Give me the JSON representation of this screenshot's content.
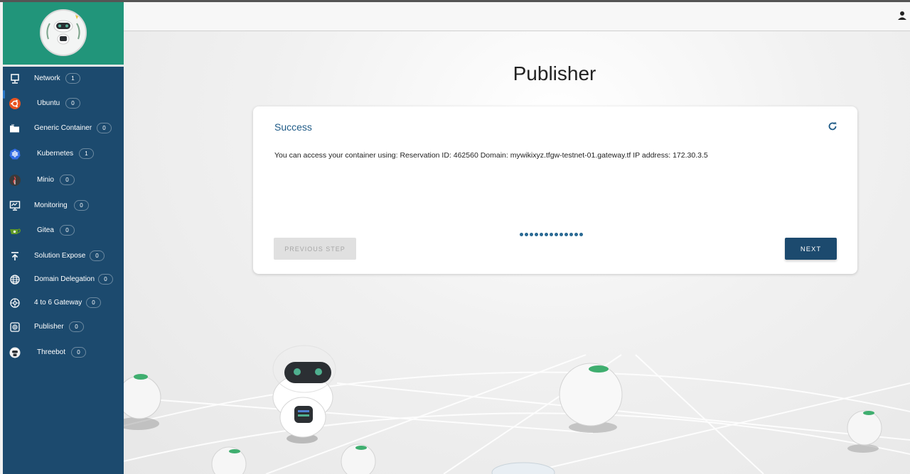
{
  "sidebar": {
    "items": [
      {
        "label": "Network",
        "count": "1",
        "icon": "monitor-icon"
      },
      {
        "label": "Ubuntu",
        "count": "0",
        "icon": "ubuntu-icon"
      },
      {
        "label": "Generic Container",
        "count": "0",
        "icon": "folder-icon"
      },
      {
        "label": "Kubernetes",
        "count": "1",
        "icon": "kubernetes-icon"
      },
      {
        "label": "Minio",
        "count": "0",
        "icon": "minio-icon"
      },
      {
        "label": "Monitoring",
        "count": "0",
        "icon": "monitoring-icon"
      },
      {
        "label": "Gitea",
        "count": "0",
        "icon": "gitea-icon"
      },
      {
        "label": "Solution Expose",
        "count": "0",
        "icon": "upload-icon"
      },
      {
        "label": "Domain Delegation",
        "count": "0",
        "icon": "globe-icon"
      },
      {
        "label": "4 to 6 Gateway",
        "count": "0",
        "icon": "gateway-icon"
      },
      {
        "label": "Publisher",
        "count": "0",
        "icon": "web-icon"
      },
      {
        "label": "Threebot",
        "count": "0",
        "icon": "threebot-icon"
      }
    ]
  },
  "main": {
    "title": "Publisher",
    "card": {
      "title": "Success",
      "message": "You can access your container using: Reservation ID: 462560 Domain: mywikixyz.tfgw-testnet-01.gateway.tf IP address: 172.30.3.5",
      "steps": 13,
      "prev_label": "PREVIOUS STEP",
      "next_label": "NEXT"
    }
  },
  "colors": {
    "sidebar": "#1c4a6e",
    "logo_bg": "#21957a",
    "accent": "#1f5b87",
    "next_button": "#1c4a6e"
  }
}
